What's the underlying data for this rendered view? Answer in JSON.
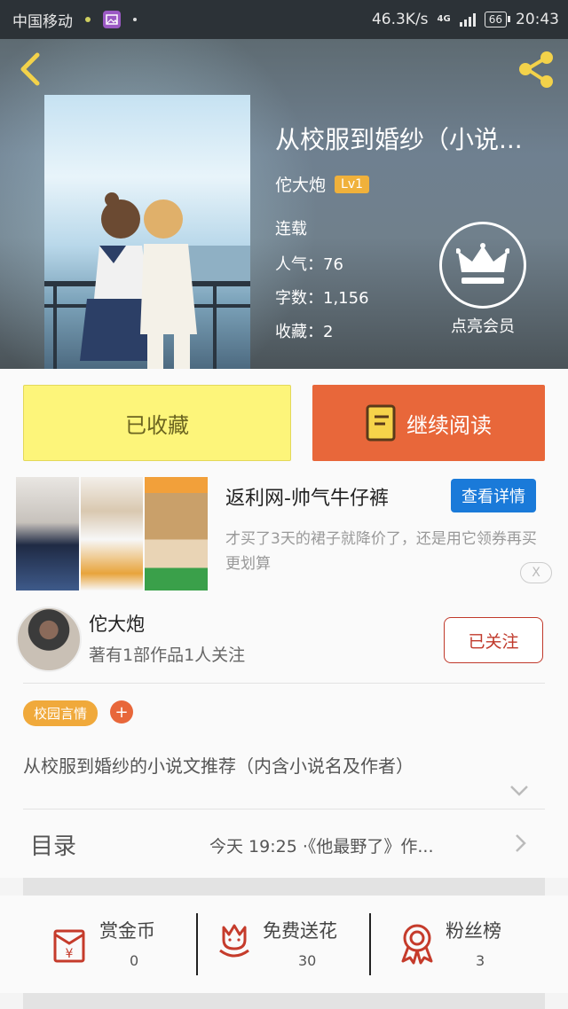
{
  "status_bar": {
    "carrier": "中国移动",
    "speed": "46.3K/s",
    "network": "4G",
    "battery": "66",
    "time": "20:43"
  },
  "book": {
    "title": "从校服到婚纱（小说...",
    "author": "佗大炮",
    "level": "Lv1",
    "status": "连载",
    "popularity": "人气：76",
    "word_count": "字数：1,156",
    "favorites": "收藏：2",
    "vip_label": "点亮会员"
  },
  "buttons": {
    "favorited": "已收藏",
    "continue_reading": "继续阅读"
  },
  "ad": {
    "title": "返利网-帅气牛仔裤",
    "detail_button": "查看详情",
    "description": "才买了3天的裙子就降价了，还是用它领券再买更划算",
    "close_label": "X"
  },
  "author_info": {
    "name": "佗大炮",
    "stats": "著有1部作品1人关注",
    "follow_button": "已关注"
  },
  "tags": {
    "tag1": "校园言情",
    "add": "+"
  },
  "description": "从校服到婚纱的小说文推荐（内含小说名及作者）",
  "toc": {
    "label": "目录",
    "latest": "今天 19:25 ·《他最野了》作..."
  },
  "actions": [
    {
      "label": "赏金币",
      "count": "0"
    },
    {
      "label": "免费送花",
      "count": "30"
    },
    {
      "label": "粉丝榜",
      "count": "3"
    }
  ],
  "colors": {
    "accent_orange": "#e8673a",
    "favorite_yellow": "#fdf57a",
    "ad_blue": "#1a7ad9",
    "follow_red": "#c0392b",
    "tag_orange": "#f0a93b",
    "icon_red": "#c53b2b"
  }
}
